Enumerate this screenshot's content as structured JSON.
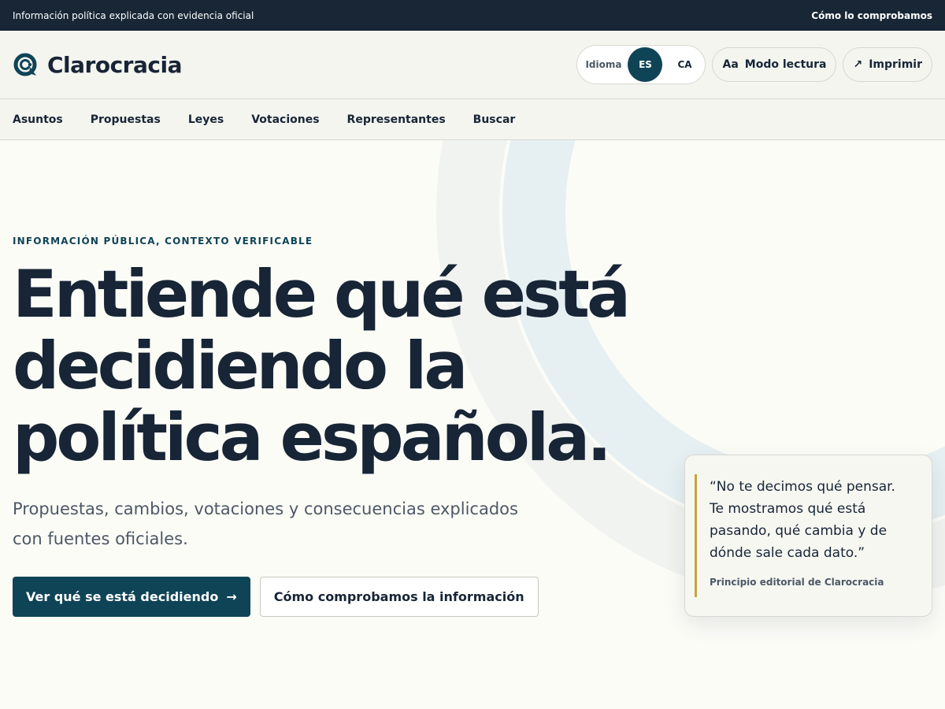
{
  "topbar": {
    "tagline": "Información política explicada con evidencia oficial",
    "link": "Cómo lo comprobamos"
  },
  "header": {
    "brand": "Clarocracia",
    "language_label": "Idioma",
    "languages": [
      {
        "code": "ES",
        "active": true
      },
      {
        "code": "CA",
        "active": false
      }
    ],
    "reading_mode_icon": "Aa",
    "reading_mode": "Modo lectura",
    "print_icon": "↗",
    "print": "Imprimir"
  },
  "nav": {
    "items": [
      "Asuntos",
      "Propuestas",
      "Leyes",
      "Votaciones",
      "Representantes",
      "Buscar"
    ]
  },
  "hero": {
    "eyebrow": "INFORMACIÓN PÚBLICA, CONTEXTO VERIFICABLE",
    "headline_lines": [
      "Entiende qué está",
      "decidiendo la",
      "política española."
    ],
    "lede_lines": [
      "Propuestas, cambios, votaciones y consecuencias explicados",
      "con fuentes oficiales."
    ],
    "primary_cta": "Ver qué se está decidiendo",
    "primary_cta_icon": "→",
    "secondary_cta": "Cómo comprobamos la información"
  },
  "quote": {
    "lines": [
      "“No te decimos qué pensar.",
      "Te mostramos qué está",
      "pasando, qué cambia y de",
      "dónde sale cada dato.”"
    ],
    "source": "Principio editorial de Clarocracia"
  },
  "colors": {
    "dark": "#182636",
    "accent": "#0f4457",
    "quote_border": "#c9a43a",
    "background": "#fcfcf7"
  }
}
